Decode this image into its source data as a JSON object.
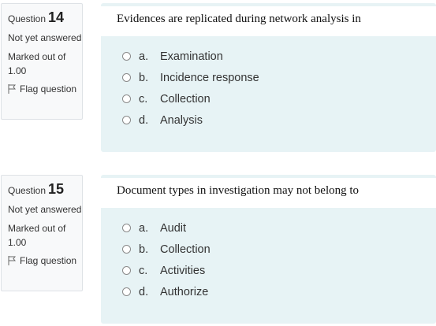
{
  "questions": [
    {
      "label": "Question",
      "number": "14",
      "state": "Not yet answered",
      "grade": "Marked out of 1.00",
      "flag_label": "Flag question",
      "text": "Evidences are replicated during network analysis in",
      "options": [
        {
          "letter": "a.",
          "text": "Examination"
        },
        {
          "letter": "b.",
          "text": "Incidence response"
        },
        {
          "letter": "c.",
          "text": "Collection"
        },
        {
          "letter": "d.",
          "text": "Analysis"
        }
      ]
    },
    {
      "label": "Question",
      "number": "15",
      "state": "Not yet answered",
      "grade": "Marked out of 1.00",
      "flag_label": "Flag question",
      "text": "Document types in investigation may not belong to",
      "options": [
        {
          "letter": "a.",
          "text": "Audit"
        },
        {
          "letter": "b.",
          "text": "Collection"
        },
        {
          "letter": "c.",
          "text": "Activities"
        },
        {
          "letter": "d.",
          "text": "Authorize"
        }
      ]
    }
  ],
  "icons": {
    "flag": "flag-icon",
    "radio": "radio-unchecked-icon"
  }
}
